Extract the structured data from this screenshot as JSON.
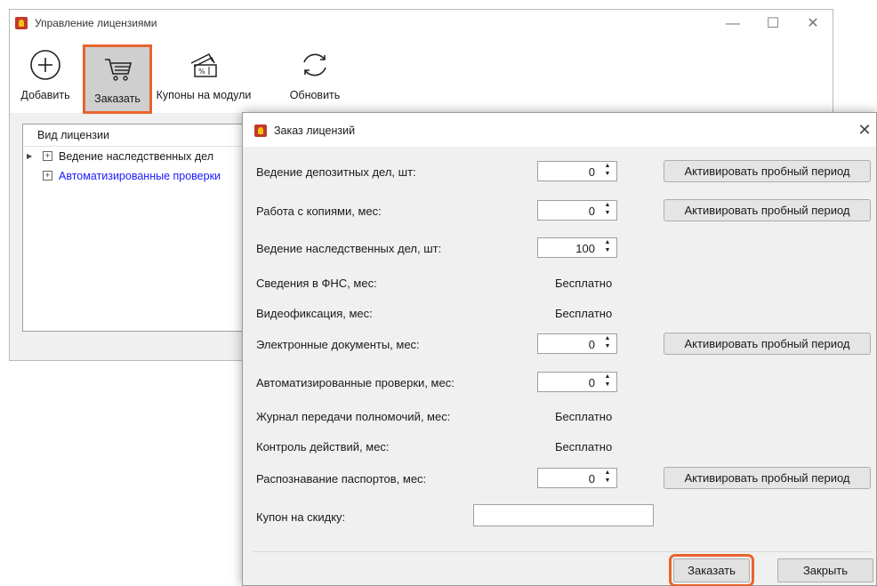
{
  "main_window": {
    "title": "Управление лицензиями",
    "controls": {
      "minimize": "—",
      "maximize": "☐",
      "close": "✕"
    },
    "toolbar": {
      "add_label": "Добавить",
      "order_label": "Заказать",
      "coupons_label": "Купоны на модули",
      "refresh_label": "Обновить"
    },
    "tree": {
      "header": "Вид лицензии",
      "rows": [
        {
          "text": "Ведение наследственных дел"
        },
        {
          "text": "Автоматизированные проверки"
        }
      ]
    }
  },
  "dialog": {
    "title": "Заказ лицензий",
    "close": "✕",
    "rows": [
      {
        "label": "Ведение депозитных дел, шт:",
        "value": "0",
        "trial": "Активировать пробный период"
      },
      {
        "label": "Работа с копиями, мес:",
        "value": "0",
        "trial": "Активировать пробный период"
      },
      {
        "label": "Ведение наследственных дел, шт:",
        "value": "100"
      },
      {
        "label": "Сведения в ФНС, мес:",
        "free": "Бесплатно"
      },
      {
        "label": "Видеофиксация, мес:",
        "free": "Бесплатно"
      },
      {
        "label": "Электронные документы, мес:",
        "value": "0",
        "trial": "Активировать пробный период"
      },
      {
        "label": "Автоматизированные проверки, мес:",
        "value": "0"
      },
      {
        "label": "Журнал передачи полномочий, мес:",
        "free": "Бесплатно"
      },
      {
        "label": "Контроль действий, мес:",
        "free": "Бесплатно"
      },
      {
        "label": "Распознавание паспортов, мес:",
        "value": "0",
        "trial": "Активировать пробный период"
      }
    ],
    "coupon_label": "Купон на скидку:",
    "coupon_value": "",
    "order_button": "Заказать",
    "close_button": "Закрыть"
  },
  "colors": {
    "highlight": "#e8642c",
    "link": "#1a1aff",
    "window_bg": "#f0f0f0"
  }
}
